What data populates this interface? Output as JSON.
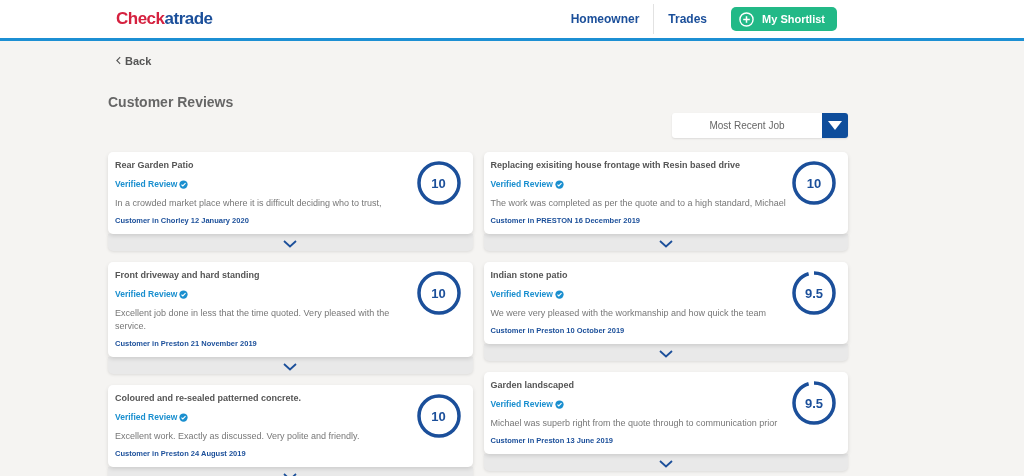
{
  "header": {
    "logo": {
      "part_1": "Check",
      "part_2": "atrade"
    },
    "nav": [
      {
        "label": "Homeowner"
      },
      {
        "label": "Trades"
      }
    ],
    "shortlist_button": "My Shortlist"
  },
  "back_link": "Back",
  "page_title": "Customer Reviews",
  "sort_dropdown": {
    "value": "Most Recent Job"
  },
  "columns": [
    {
      "reviews": [
        {
          "title": "Rear Garden Patio",
          "verified": "Verified Review",
          "text": "In a crowded market place where it is difficult deciding who to trust,",
          "customer": "Customer in Chorley 12 January 2020",
          "score": "10",
          "level": 1
        },
        {
          "title": "Front driveway and hard standing",
          "verified": "Verified Review",
          "text": "Excellent job done in less that the time quoted. Very pleased with the service.",
          "customer": "Customer in Preston 21 November 2019",
          "score": "10",
          "level": 1
        },
        {
          "title": "Coloured and re-sealed patterned concrete.",
          "verified": "Verified Review",
          "text": "Excellent work. Exactly as discussed. Very polite and friendly.",
          "customer": "Customer in Preston 24 August 2019",
          "score": "10",
          "level": 1
        }
      ]
    },
    {
      "reviews": [
        {
          "title": "Replacing exisiting house frontage with Resin based drive",
          "verified": "Verified Review",
          "text": "The work was completed as per the quote and to a high standard, Michael",
          "customer": "Customer in PRESTON 16 December 2019",
          "score": "10",
          "level": 1
        },
        {
          "title": "Indian stone patio",
          "verified": "Verified Review",
          "text": "We were very pleased with the workmanship and how quick the team",
          "customer": "Customer in Preston 10 October 2019",
          "score": "9.5",
          "level": 0.95
        },
        {
          "title": "Garden landscaped",
          "verified": "Verified Review",
          "text": "Michael was superb right from the quote through to communication prior",
          "customer": "Customer in Preston 13 June 2019",
          "score": "9.5",
          "level": 0.95
        }
      ]
    }
  ]
}
